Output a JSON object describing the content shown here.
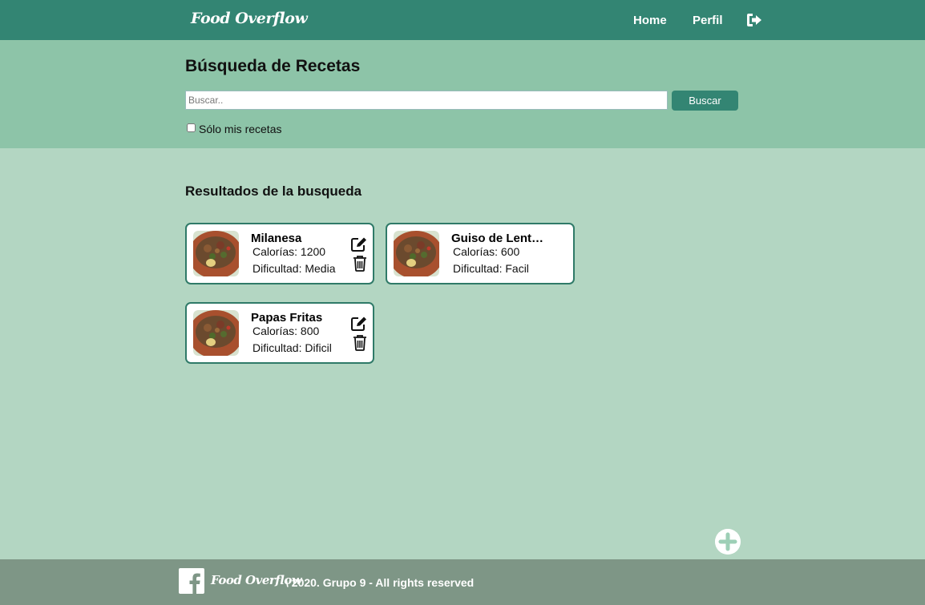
{
  "navbar": {
    "brand": "Food Overflow",
    "links": [
      "Home",
      "Perfil"
    ],
    "logout_icon": "sign-out-icon"
  },
  "search": {
    "title": "Búsqueda de Recetas",
    "placeholder": "Buscar..",
    "value": "",
    "button_label": "Buscar",
    "only_mine_label": "Sólo mis recetas",
    "only_mine_checked": false
  },
  "results": {
    "title": "Resultados de la busqueda",
    "cards": [
      {
        "name": "Milanesa",
        "calories": "Calorías: 1200",
        "difficulty": "Dificultad: Media",
        "editable": true
      },
      {
        "name": "Guiso de Lentejas",
        "calories": "Calorías: 600",
        "difficulty": "Dificultad: Facil",
        "editable": false
      },
      {
        "name": "Papas Fritas",
        "calories": "Calorías: 800",
        "difficulty": "Dificultad: Dificil",
        "editable": true
      }
    ]
  },
  "add_button": {
    "icon": "plus-circle-icon"
  },
  "footer": {
    "brand": "Food Overflow",
    "text": "\\ 2020. Grupo 9 - All rights reserved",
    "icon": "facebook-icon"
  },
  "colors": {
    "navbar": "#338573",
    "search_panel": "#8dc4a8",
    "background": "#b3d6c2",
    "footer": "#7e9686",
    "card_border": "#2f7a68"
  }
}
